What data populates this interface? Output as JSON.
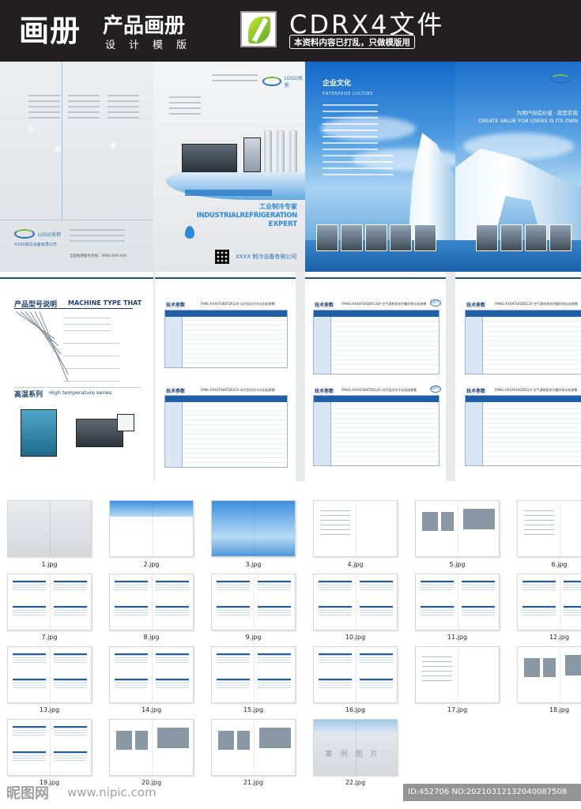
{
  "header": {
    "title_main": "画册",
    "title_product": "产品画册",
    "title_design": "设计模版",
    "format_label": "CDRX4文件",
    "note": "本资料内容已打乱，只做模版用"
  },
  "cover": {
    "company_small": "XXXX制冷设备有限公司",
    "logo_text": "LOGO名称",
    "hotline": "全国免费服务热线：4006-000-000",
    "slogan_cn": "工业制冷专家",
    "slogan_en_1": "INDUSTRIALREFRIGERATION",
    "slogan_en_2": "EXPERT",
    "company_big": "XXXX 制冷设备有限公司",
    "culture_cn": "企业文化",
    "culture_en": "ENTERPRISE CULTURE",
    "value_cn": "为用户创造价值 · 就是实现",
    "value_en": "CREATE VALUE FOR USERS  IS ITS OWN"
  },
  "spec": {
    "type_title_cn": "产品型号说明",
    "type_title_en": "MACHINE TYPE THAT",
    "ht_title_cn": "高温系列",
    "ht_title_en": "High temperature series",
    "table_label": "技术参数",
    "table_captions": [
      "FMKL-XXXXFSKKTDR22A 风冷型风冷冷水机组参数",
      "FMKL-XXXXFSKKTDR22A 风冷型风冷冷水机组参数",
      "FMHG-XXXXFSKSDR134A 空气源热泵系列循环热水机参数",
      "FMHG-XXXXFSKSDR22A 空气源热泵系列循环热水机参数",
      "FMHG-XXXXFSKKTDR22A 风冷型风冷冷水机组参数",
      "FMKG-XXXXFSKSDR22A 空气源热泵系列循环热水机参数"
    ],
    "badge": "65℃",
    "badge2": "60℃"
  },
  "thumbnails": [
    "1.jpg",
    "2.jpg",
    "3.jpg",
    "4.jpg",
    "5.jpg",
    "6.jpg",
    "7.jpg",
    "8.jpg",
    "9.jpg",
    "10.jpg",
    "11.jpg",
    "12.jpg",
    "13.jpg",
    "14.jpg",
    "15.jpg",
    "16.jpg",
    "17.jpg",
    "18.jpg",
    "19.jpg",
    "20.jpg",
    "21.jpg",
    "22.jpg"
  ],
  "case_label": "案例图片",
  "watermark": {
    "logo": "昵图网",
    "url": "www.nipic.com",
    "id": "ID:452706 NO:20210312132040087508"
  },
  "colors": {
    "header_bg": "#231f20",
    "brand_blue": "#2a8ad6",
    "table_blue": "#1f5ea8"
  }
}
